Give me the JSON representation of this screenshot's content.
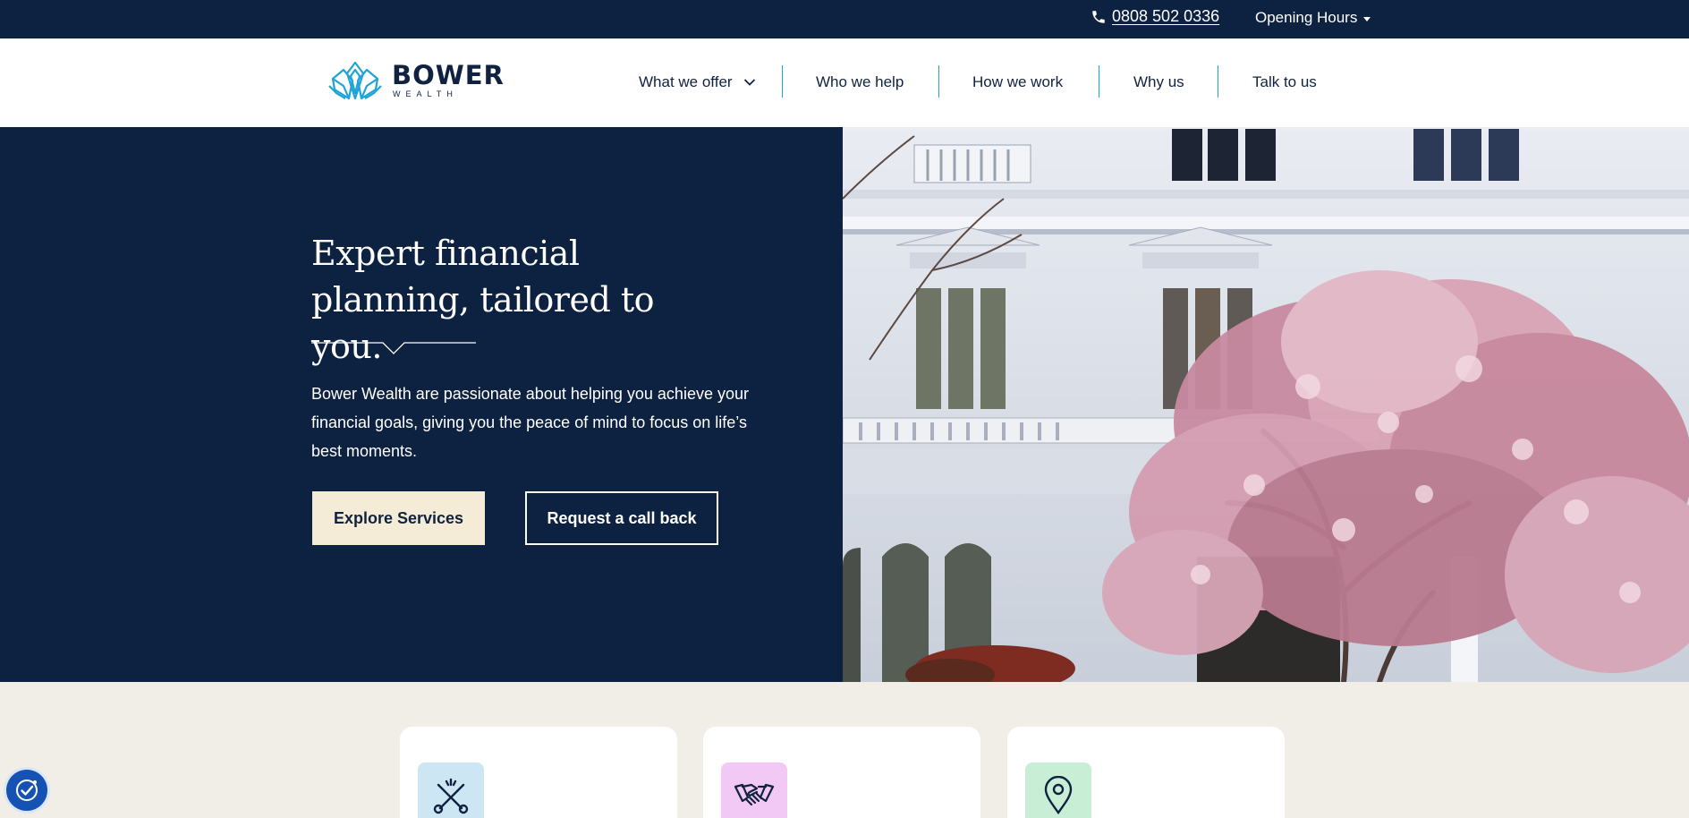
{
  "topbar": {
    "phone_icon": "phone-icon",
    "phone": "0808 502 0336",
    "hours_label": "Opening Hours"
  },
  "brand": {
    "name": "BOWER",
    "sub": "WEALTH",
    "colors": {
      "navy": "#0d2140",
      "accent": "#1ea4d6",
      "cream": "#f4ecd6",
      "sand": "#f1eee7"
    }
  },
  "nav": {
    "items": [
      {
        "label": "What we offer",
        "has_dropdown": true
      },
      {
        "label": "Who we help"
      },
      {
        "label": "How we work"
      },
      {
        "label": "Why us"
      },
      {
        "label": "Talk to us"
      }
    ]
  },
  "hero": {
    "title": "Expert financial planning, tailored to you.",
    "body": "Bower Wealth are passionate about helping you achieve your financial goals, giving you the peace of mind to focus on life’s best moments.",
    "primary_button": "Explore Services",
    "secondary_button": "Request a call back",
    "image": "white-building-with-magnolia-tree"
  },
  "cards": [
    {
      "icon": "tools-crossed-icon",
      "icon_bg": "#cde6f3"
    },
    {
      "icon": "handshake-icon",
      "icon_bg": "#f2c9f4"
    },
    {
      "icon": "map-pin-icon",
      "icon_bg": "#c8efd6"
    }
  ],
  "accessibility": {
    "icon": "accessibility-icon"
  }
}
